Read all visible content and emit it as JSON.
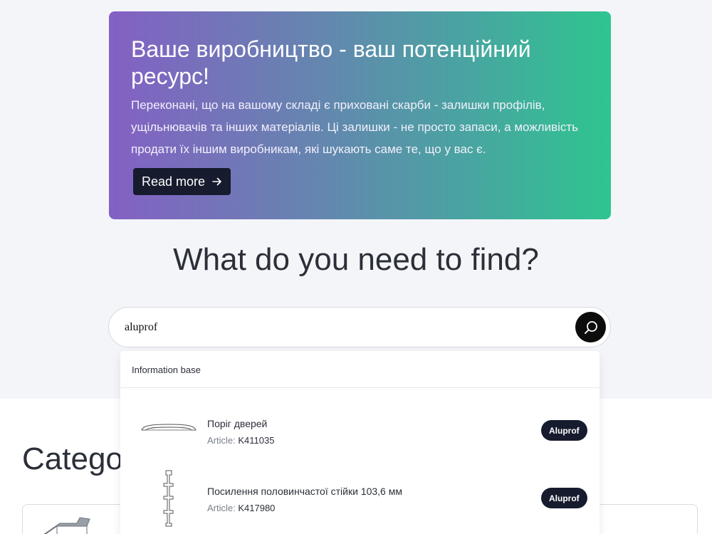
{
  "hero": {
    "title": "Ваше виробництво - ваш потенційний ресурс!",
    "text": "Переконані, що на вашому складі є приховані скарби - залишки профілів, ущільнювачів та інших матеріалів. Ці залишки - не просто запаси, а можливість продати їх іншим виробникам, які шукають саме те, що у вас є.",
    "button_label": "Read more",
    "button_icon": "arrow-right-icon"
  },
  "search": {
    "heading": "What do you need to find?",
    "value": "aluprof",
    "button_icon": "search-icon"
  },
  "dropdown": {
    "section_title": "Information base",
    "results": [
      {
        "name": "Поріг дверей",
        "article_label": "Article:",
        "article": "K411035",
        "brand": "Aluprof"
      },
      {
        "name": "Посилення половинчастої стійки 103,6 мм",
        "article_label": "Article:",
        "article": "K417980",
        "brand": "Aluprof"
      }
    ]
  },
  "categories": {
    "title": "Categories"
  }
}
